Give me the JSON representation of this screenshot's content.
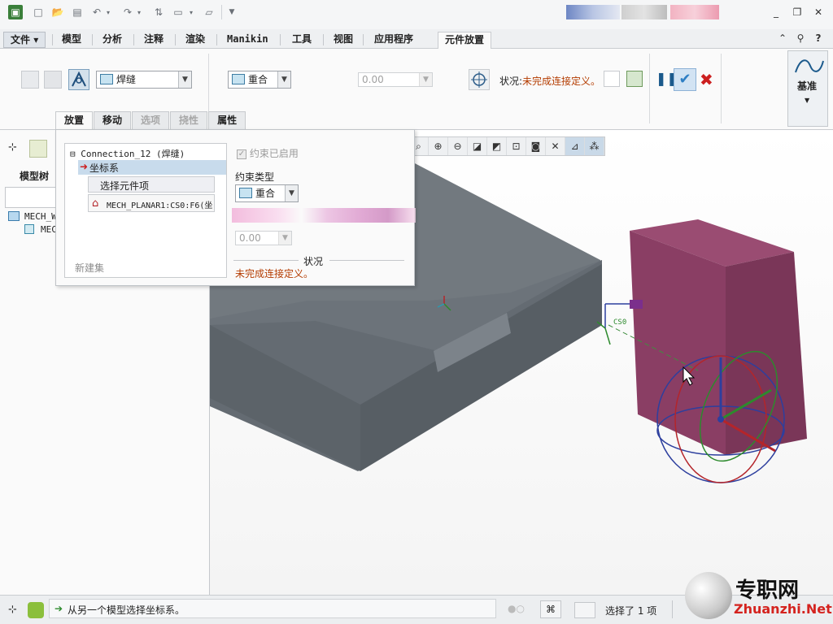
{
  "tabs": {
    "file": "文件",
    "model": "模型",
    "analysis": "分析",
    "annotate": "注释",
    "render": "渲染",
    "manikin": "Manikin",
    "tools": "工具",
    "view": "视图",
    "applications": "应用程序",
    "component_placement": "元件放置"
  },
  "ribbon": {
    "connection_type": "焊缝",
    "constraint_type": "重合",
    "offset_value": "0.00",
    "status_label": "状况:",
    "status_value": "未完成连接定义。",
    "datum_label": "基准"
  },
  "subtabs": {
    "placement": "放置",
    "move": "移动",
    "options": "选项",
    "flexibility": "挠性",
    "properties": "属性"
  },
  "panel": {
    "connection_name": "Connection_12 (焊缝)",
    "constraint_item": "坐标系",
    "select_component_item": "选择元件项",
    "reference_item": "MECH_PLANAR1:CS0:F6(坐",
    "new_set": "新建集",
    "constraint_enabled": "约束已启用",
    "constraint_type_label": "约束类型",
    "constraint_type_value": "重合",
    "offset_value": "0.00",
    "status_title": "状况",
    "status_value": "未完成连接定义。"
  },
  "left": {
    "model_tree": "模型树",
    "root_item": "MECH_W",
    "child_item": "MEC"
  },
  "viewport": {
    "csys_label": "CS0"
  },
  "status_bar": {
    "message": "从另一个模型选择坐标系。",
    "selected": "选择了 1 项"
  },
  "watermark": {
    "text_cn": "专职网",
    "text_en": "Zhuanzhi.Net"
  },
  "colors": {
    "accent_blue": "#1c5a8c",
    "status_orange": "#b43c00",
    "confirm_check": "#2f7fc4",
    "cancel_x": "#cc1f1f",
    "part_gray": "#6e757c",
    "part_maroon": "#8a3e64"
  }
}
